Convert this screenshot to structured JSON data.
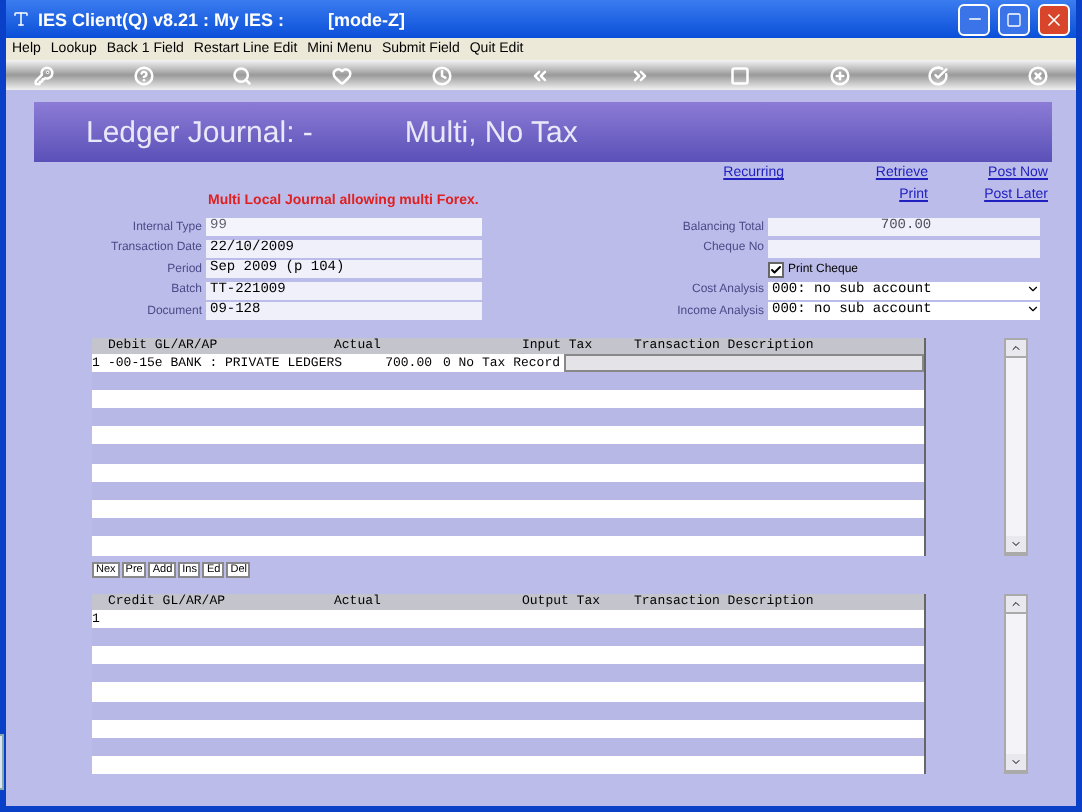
{
  "window": {
    "title": "IES Client(Q) v8.21 : My IES :",
    "mode": "[mode-Z]"
  },
  "menu": [
    "Help",
    "Lookup",
    "Back 1 Field",
    "Restart Line Edit",
    "Mini Menu",
    "Submit Field",
    "Quit Edit"
  ],
  "header": {
    "title": "Ledger Journal: -",
    "subtitle": "Multi, No Tax"
  },
  "links_top": [
    "Recurring",
    "Retrieve",
    "Post Now"
  ],
  "links_bottom": [
    "Print",
    "Post Later"
  ],
  "notice": "Multi Local Journal allowing multi Forex.",
  "left_fields": [
    {
      "label": "Internal Type",
      "value": "99",
      "disabled": true
    },
    {
      "label": "Transaction Date",
      "value": "22/10/2009",
      "disabled": false
    },
    {
      "label": "Period",
      "value": "Sep 2009 (p 104)",
      "disabled": false
    },
    {
      "label": "Batch",
      "value": "TT-221009",
      "disabled": false
    },
    {
      "label": "Document",
      "value": "09-128",
      "disabled": false
    }
  ],
  "right_fields": [
    {
      "kind": "field",
      "label": "Balancing Total",
      "value": "700.00"
    },
    {
      "kind": "field",
      "label": "Cheque No"
    },
    {
      "kind": "checkbox",
      "label": "Print Cheque",
      "checked": true
    },
    {
      "kind": "select",
      "label": "Cost Analysis",
      "value": "000: no sub account"
    },
    {
      "kind": "select",
      "label": "Income Analysis",
      "value": "000: no sub account"
    }
  ],
  "debit_grid": {
    "columns": [
      "Debit GL/AR/AP",
      "Actual",
      "Input Tax",
      "Transaction Description"
    ],
    "rows": [
      {
        "number": "1",
        "account": "-00-15e BANK : PRIVATE LEDGERS",
        "actual": "700.00",
        "tax": "0 No Tax Record"
      }
    ]
  },
  "buttons": [
    "Nex",
    "Pre",
    "Add",
    "Ins",
    "Ed",
    "Del"
  ],
  "credit_grid": {
    "columns": [
      "Credit GL/AR/AP",
      "Actual",
      "Output Tax",
      "Transaction Description"
    ],
    "rows": [
      {
        "number": "1"
      }
    ]
  }
}
